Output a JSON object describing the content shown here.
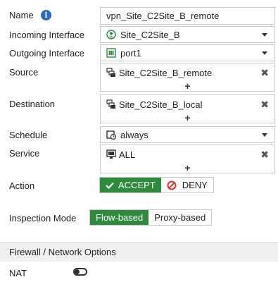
{
  "form": {
    "name": {
      "label": "Name",
      "value": "vpn_Site_C2Site_B_remote"
    },
    "incoming_interface": {
      "label": "Incoming Interface",
      "value": "Site_C2Site_B"
    },
    "outgoing_interface": {
      "label": "Outgoing Interface",
      "value": "port1"
    },
    "source": {
      "label": "Source",
      "value": "Site_C2Site_B_remote",
      "add": "+"
    },
    "destination": {
      "label": "Destination",
      "value": "Site_C2Site_B_local",
      "add": "+"
    },
    "schedule": {
      "label": "Schedule",
      "value": "always"
    },
    "service": {
      "label": "Service",
      "value": "ALL",
      "add": "+"
    },
    "action": {
      "label": "Action",
      "accept": "ACCEPT",
      "deny": "DENY",
      "selected": "ACCEPT"
    },
    "inspection_mode": {
      "label": "Inspection Mode",
      "flow": "Flow-based",
      "proxy": "Proxy-based",
      "selected": "Flow-based"
    }
  },
  "firewall_section": {
    "title": "Firewall / Network Options"
  },
  "nat": {
    "label": "NAT",
    "enabled": false
  },
  "colors": {
    "accent_green": "#2e8b3d",
    "deny_red": "#d9342b",
    "info_blue": "#2a6bb8"
  },
  "icons": {
    "incoming": "vpn-tunnel-icon",
    "outgoing": "port-icon",
    "address": "address-object-icon",
    "schedule": "schedule-icon",
    "service": "service-icon",
    "remove": "close-icon"
  }
}
